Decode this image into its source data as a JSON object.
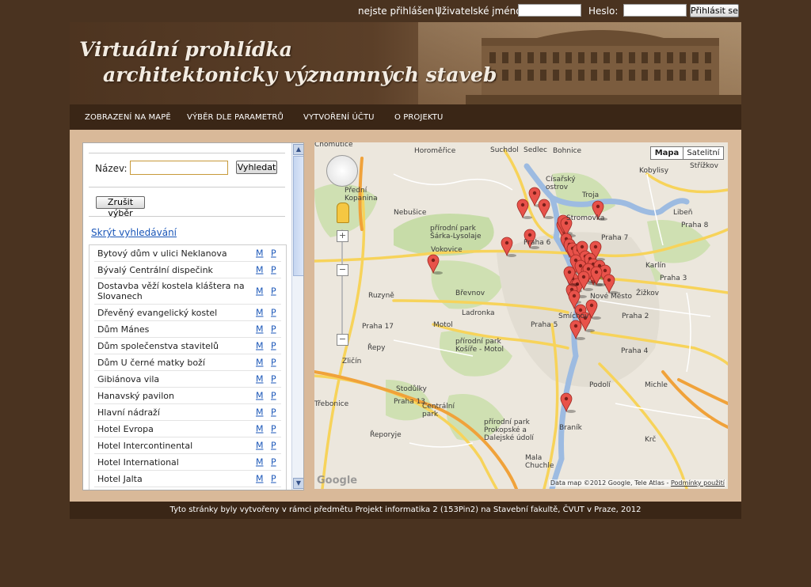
{
  "login": {
    "status": "nejste přihlášen |",
    "username_label": "Uživatelské jméno:",
    "password_label": "Heslo:",
    "login_button": "Přihlásit se"
  },
  "banner": {
    "title_line1": "Virtuální prohlídka",
    "title_line2": "architektonicky významných staveb"
  },
  "nav": {
    "items": [
      "ZOBRAZENÍ NA MAPĚ",
      "VÝBĚR DLE PARAMETRŮ",
      "VYTVOŘENÍ ÚČTU",
      "O PROJEKTU"
    ]
  },
  "search": {
    "name_label": "Název:",
    "search_button": "Vyhledat",
    "clear_button": "Zrušit výběr",
    "hide_link": "Skrýt vyhledávání"
  },
  "buildings": {
    "m_label": "M",
    "p_label": "P",
    "items": [
      "Bytový dům v ulici Neklanova",
      "Bývalý Centrální dispečink",
      "Dostavba věží kostela kláštera na Slovanech",
      "Dřevěný evangelický kostel",
      "Dům Mánes",
      "Dům společenstva stavitelů",
      "Dům U černé matky boží",
      "Gibiánova vila",
      "Hanavský pavilon",
      "Hlavní nádraží",
      "Hotel Evropa",
      "Hotel Intercontinental",
      "Hotel International",
      "Hotel Jalta"
    ]
  },
  "map": {
    "map_type": "Mapa",
    "satellite_type": "Satelitní",
    "attribution": "Data map ©2012 Google, Tele Atlas -",
    "terms": "Podmínky použití",
    "logo": "Google",
    "zoom_in": "+",
    "zoom_out": "−",
    "places": [
      "Chomutice",
      "Horoměřice",
      "Suchdol",
      "Sedlec",
      "Bohnice",
      "Kobylisy",
      "Střížkov",
      "Přední Kopanina",
      "Nebušice",
      "Císařský ostrov",
      "Troja",
      "Libeň",
      "Praha 8",
      "přírodní park Šárka-Lysolaje",
      "Stromovka",
      "Praha 7",
      "Vokovice",
      "Praha 6",
      "Karlín",
      "Praha 3",
      "Žižkov",
      "Ruzyně",
      "Břevnov",
      "Praha 17",
      "Ladronka",
      "Motol",
      "Praha 5",
      "Praha 2",
      "Praha 4",
      "Řepy",
      "přírodní park Košíře - Motol",
      "Zličín",
      "Stodůlky",
      "Praha 13",
      "Centrální park",
      "Michle",
      "Podolí",
      "Řeporyje",
      "přírodní park Prokopské a Dalejské údolí",
      "Braník",
      "Krč",
      "Mala Chuchle",
      "Smíchov",
      "Nové Město",
      "Třebonice"
    ]
  },
  "footer": {
    "text": "Tyto stránky byly vytvořeny v rámci předmětu Projekt informatika 2 (153Pin2) na Stavební fakultě, ČVUT v Praze, 2012"
  },
  "colors": {
    "background": "#4a3320",
    "bar": "#3a2616",
    "content": "#d9b999",
    "link": "#1a56b8",
    "marker": "#e8524a"
  }
}
